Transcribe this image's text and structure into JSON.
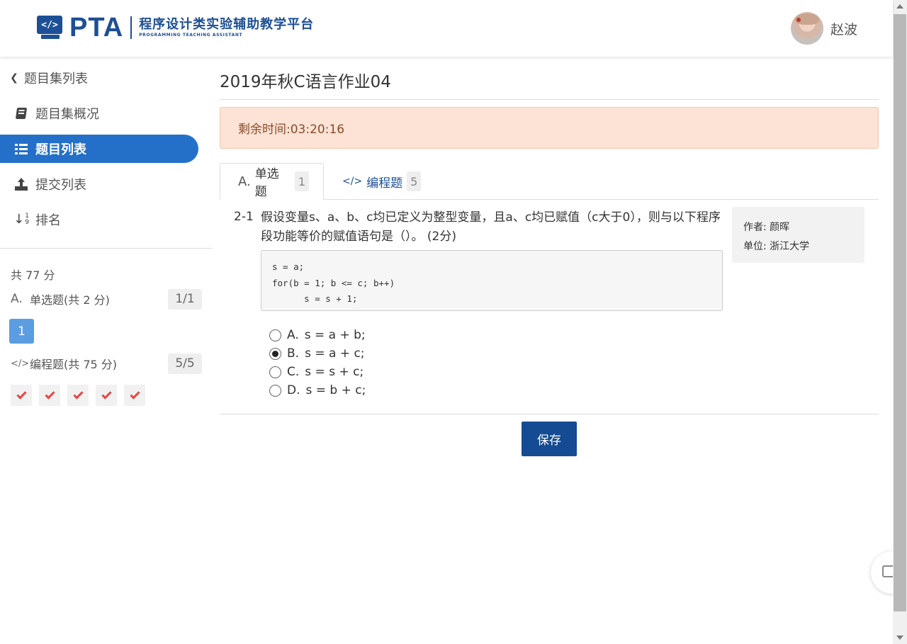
{
  "header": {
    "logo_badge": "</>",
    "logo_text": "PTA",
    "logo_subtitle_cn": "程序设计类实验辅助教学平台",
    "logo_subtitle_en": "PROGRAMMING TEACHING ASSISTANT",
    "user_name": "赵波"
  },
  "sidebar": {
    "back_label": "题目集列表",
    "items": [
      {
        "label": "题目集概况",
        "icon": "book-icon"
      },
      {
        "label": "题目列表",
        "icon": "list-icon",
        "active": true
      },
      {
        "label": "提交列表",
        "icon": "upload-icon"
      },
      {
        "label": "排名",
        "icon": "sort-numeric-icon"
      }
    ],
    "total": "共 77 分",
    "sections": [
      {
        "icon_text": "A.",
        "label": "单选题(共 2 分)",
        "count": "1/1",
        "questions": [
          "1"
        ]
      },
      {
        "icon_text": "</>",
        "label": "编程题(共 75 分)",
        "count": "5/5",
        "questions_status": [
          "done",
          "done",
          "done",
          "done",
          "done"
        ]
      }
    ],
    "active_color": "#2470c9"
  },
  "main": {
    "title": "2019年秋C语言作业04",
    "timer": "剩余时间:03:20:16",
    "tabs": [
      {
        "icon_text": "A.",
        "label": "单选题",
        "count": "1",
        "active": true
      },
      {
        "icon_text": "</>",
        "label": "编程题",
        "count": "5",
        "active": false
      }
    ],
    "question": {
      "number": "2-1",
      "text": "假设变量s、a、b、c均已定义为整型变量，且a、c均已赋值（c大于0），则与以下程序段功能等价的赋值语句是（）。 (2分)",
      "code": [
        "s = a;",
        "for(b = 1; b <= c; b++)",
        "      s = s + 1;"
      ],
      "author": "作者: 颜晖",
      "unit": "单位: 浙江大学",
      "options": [
        {
          "letter": "A.",
          "text": "s = a + b;",
          "checked": false
        },
        {
          "letter": "B.",
          "text": "s = a + c;",
          "checked": true
        },
        {
          "letter": "C.",
          "text": "s = s + c;",
          "checked": false
        },
        {
          "letter": "D.",
          "text": "s = b + c;",
          "checked": false
        }
      ]
    },
    "save_label": "保存"
  }
}
